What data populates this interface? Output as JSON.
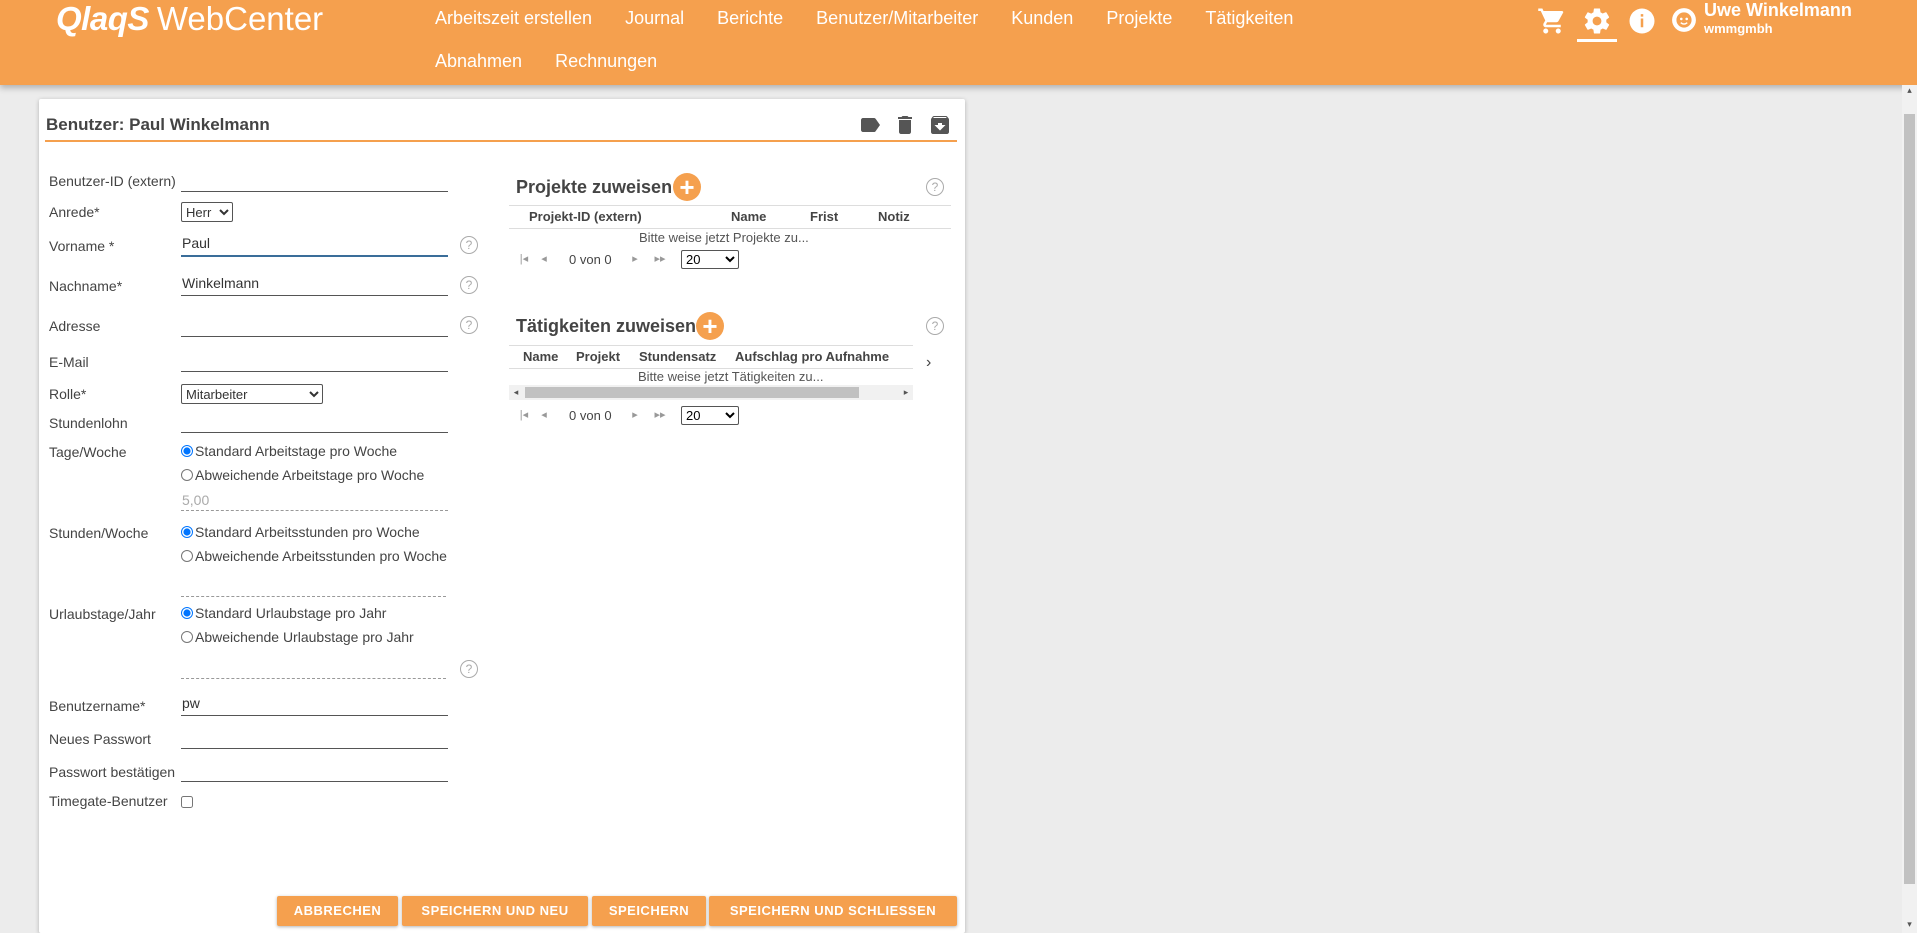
{
  "header": {
    "logo_brand": "QlaqS",
    "logo_product": "WebCenter",
    "nav_row1": [
      "Arbeitszeit erstellen",
      "Journal",
      "Berichte",
      "Benutzer/Mitarbeiter",
      "Kunden",
      "Projekte",
      "Tätigkeiten"
    ],
    "nav_row2": [
      "Abnahmen",
      "Rechnungen"
    ],
    "icons": [
      "cart-icon",
      "gear-icon",
      "info-icon",
      "user-avatar-icon"
    ],
    "user_name": "Uwe Winkelmann",
    "user_company": "wmmgmbh"
  },
  "card": {
    "title": "Benutzer: Paul Winkelmann",
    "tools": [
      "tag-icon",
      "trash-icon",
      "archive-icon"
    ]
  },
  "form": {
    "ext_id_label": "Benutzer-ID (extern)",
    "ext_id_value": "",
    "salutation_label": "Anrede*",
    "salutation_value": "Herr",
    "firstname_label": "Vorname *",
    "firstname_value": "Paul",
    "lastname_label": "Nachname*",
    "lastname_value": "Winkelmann",
    "address_label": "Adresse",
    "address_value": "",
    "email_label": "E-Mail",
    "email_value": "",
    "role_label": "Rolle*",
    "role_value": "Mitarbeiter",
    "wage_label": "Stundenlohn",
    "wage_value": "",
    "days_label": "Tage/Woche",
    "days_opt1": "Standard Arbeitstage pro Woche",
    "days_opt2": "Abweichende Arbeitstage pro Woche",
    "days_value": "5,00",
    "hours_label": "Stunden/Woche",
    "hours_opt1": "Standard Arbeitsstunden pro Woche",
    "hours_opt2": "Abweichende Arbeitsstunden pro Woche",
    "vacation_label": "Urlaubstage/Jahr",
    "vacation_opt1": "Standard Urlaubstage pro Jahr",
    "vacation_opt2": "Abweichende Urlaubstage pro Jahr",
    "username_label": "Benutzername*",
    "username_value": "pw",
    "newpw_label": "Neues Passwort",
    "confirmpw_label": "Passwort bestätigen",
    "timegate_label": "Timegate-Benutzer",
    "help_glyph": "?"
  },
  "projects": {
    "title": "Projekte zuweisen",
    "columns": [
      "Projekt-ID (extern)",
      "Name",
      "Frist",
      "Notiz"
    ],
    "empty_text": "Bitte weise jetzt Projekte zu...",
    "pager_text": "0 von 0",
    "page_size": "20"
  },
  "activities": {
    "title": "Tätigkeiten zuweisen",
    "columns": [
      "Name",
      "Projekt",
      "Stundensatz",
      "Aufschlag pro Aufnahme"
    ],
    "empty_text": "Bitte weise jetzt Tätigkeiten zu...",
    "pager_text": "0 von 0",
    "page_size": "20"
  },
  "buttons": {
    "cancel": "ABBRECHEN",
    "save_new": "SPEICHERN UND NEU",
    "save": "SPEICHERN",
    "save_close": "SPEICHERN UND SCHLIESSEN"
  },
  "colors": {
    "accent": "#f5a04e",
    "focus": "#3a6d99"
  }
}
